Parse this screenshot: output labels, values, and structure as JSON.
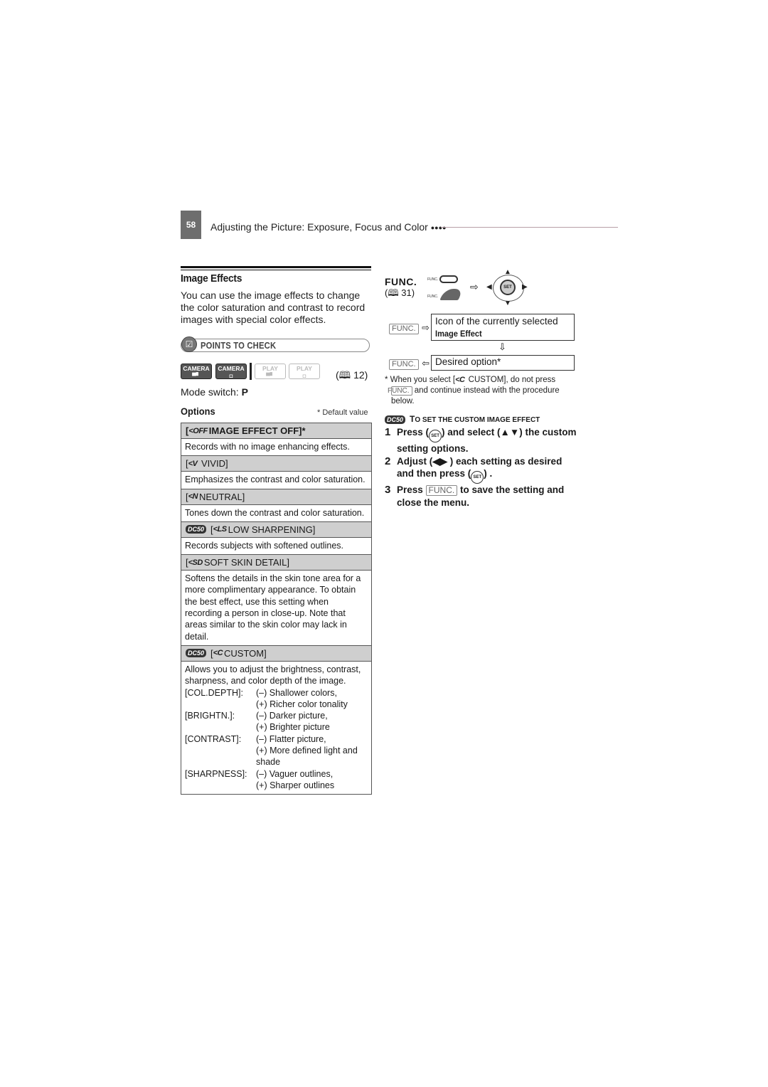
{
  "header": {
    "page_number": "58",
    "running_title": "Adjusting the Picture: Exposure, Focus and Color",
    "dots": "●●●●"
  },
  "section": {
    "title": "Image Effects",
    "intro": "You can use the image effects to change the color saturation and contrast to record images with special color effects.",
    "points_to_check": "POINTS TO CHECK",
    "mode_buttons": [
      {
        "label": "CAMERA",
        "sub": "▀▘",
        "active": true,
        "icon": "movie-camera-icon"
      },
      {
        "label": "CAMERA",
        "sub": "◘",
        "active": true,
        "icon": "still-camera-icon"
      },
      {
        "label": "PLAY",
        "sub": "▀▘",
        "active": false,
        "icon": "movie-camera-icon"
      },
      {
        "label": "PLAY",
        "sub": "◘",
        "active": false,
        "icon": "still-camera-icon"
      }
    ],
    "page_ref": "12",
    "mode_switch_label": "Mode switch:",
    "mode_switch_value": "P",
    "options_title": "Options",
    "default_note": "* Default value"
  },
  "options": [
    {
      "icon": "<OFF",
      "label": "IMAGE EFFECT OFF]*",
      "dc50": false,
      "bold": true,
      "desc": "Records with no image enhancing effects."
    },
    {
      "icon": "<V",
      "label": "VIVID]",
      "dc50": false,
      "bold": false,
      "desc": "Emphasizes the contrast and color saturation."
    },
    {
      "icon": "<N",
      "label": "NEUTRAL]",
      "dc50": false,
      "bold": false,
      "desc": "Tones down the contrast and color saturation."
    },
    {
      "icon": "<LS",
      "label": "LOW SHARPENING]",
      "dc50": true,
      "bold": false,
      "desc": "Records subjects with softened outlines."
    },
    {
      "icon": "<SD",
      "label": "SOFT SKIN DETAIL]",
      "dc50": false,
      "bold": false,
      "desc": "Softens the details in the skin tone area for a more complimentary appearance. To obtain the best effect, use this setting when recording a person in close-up. Note that areas similar to the skin color may lack in detail."
    },
    {
      "icon": "<C",
      "label": "CUSTOM]",
      "dc50": true,
      "bold": false,
      "desc": "Allows you to adjust the brightness, contrast, sharpness, and color depth of the image."
    }
  ],
  "dc50_badge": "DC50",
  "custom_params": [
    {
      "name": "[COL.DEPTH]:",
      "lines": [
        "(–) Shallower colors,",
        "(+) Richer color tonality"
      ]
    },
    {
      "name": "[BRIGHTN.]:",
      "lines": [
        "(–) Darker picture,",
        "(+) Brighter picture"
      ]
    },
    {
      "name": "[CONTRAST]:",
      "lines": [
        "(–) Flatter picture,",
        "(+) More defined light and shade"
      ]
    },
    {
      "name": "[SHARPNESS]:",
      "lines": [
        "(–) Vaguer outlines,",
        "(+) Sharper outlines"
      ]
    }
  ],
  "func": {
    "title": "FUNC.",
    "page_ref": "31",
    "btn_label": "FUNC.",
    "set_label": "SET",
    "arrow_right": "⇨",
    "arrow_left": "⇦",
    "arrow_down": "⇩",
    "box1_line1": "Icon of the currently selected",
    "box1_line2": "Image Effect",
    "box2": "Desired option*"
  },
  "footnote": {
    "part1": "* When you select [",
    "icon": "<C",
    "part2": " CUSTOM], do not press ",
    "key": "FUNC.",
    "part3": " and continue instead with the procedure below."
  },
  "custom_procedure": {
    "title_prefix": "T",
    "title_rest": "O SET THE CUSTOM IMAGE EFFECT",
    "steps": [
      {
        "num": "1",
        "parts": [
          "Press (",
          "SET",
          ") and select (▲▼) the custom setting options."
        ]
      },
      {
        "num": "2",
        "parts": [
          "Adjust (◀▶ ) each setting as desired and then press (",
          "SET",
          ") ."
        ]
      },
      {
        "num": "3",
        "parts": [
          "Press ",
          "FUNC.",
          " to save the setting and close the menu."
        ]
      }
    ]
  }
}
